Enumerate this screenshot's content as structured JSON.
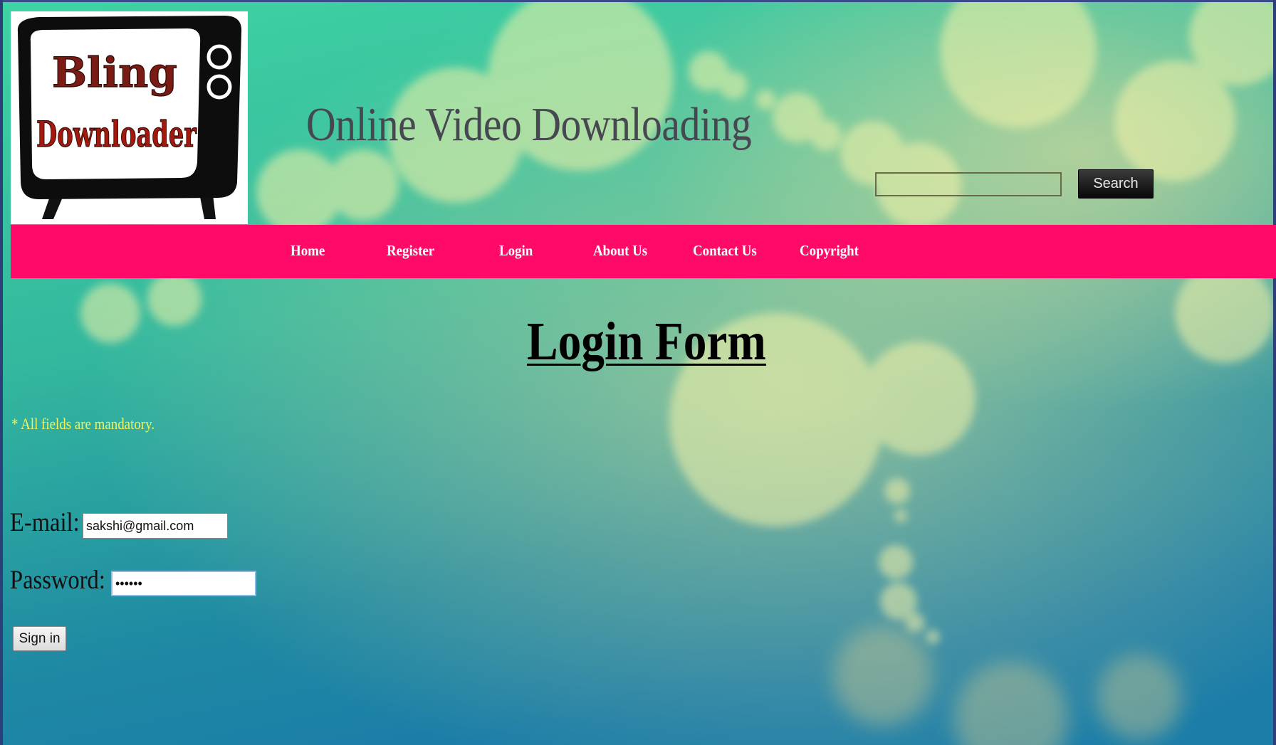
{
  "header": {
    "logo_text_line1": "Bling",
    "logo_text_line2": "Downloader",
    "site_title": "Online Video Downloading",
    "search": {
      "value": "",
      "placeholder": "",
      "button_label": "Search"
    }
  },
  "nav": {
    "items": [
      {
        "label": "Home"
      },
      {
        "label": "Register"
      },
      {
        "label": "Login"
      },
      {
        "label": "About Us"
      },
      {
        "label": "Contact Us"
      },
      {
        "label": "Copyright"
      }
    ]
  },
  "main": {
    "heading": "Login Form",
    "mandatory_note": "* All fields are mandatory.",
    "email": {
      "label": "E-mail:",
      "value": "sakshi@gmail.com"
    },
    "password": {
      "label": "Password:",
      "value": "••••••"
    },
    "signin_label": "Sign in"
  },
  "colors": {
    "navbar": "#ff0a68",
    "mandatory_note": "#f2f25a",
    "background_top": "#3fd2a0",
    "background_bottom": "#1a7aa0"
  }
}
